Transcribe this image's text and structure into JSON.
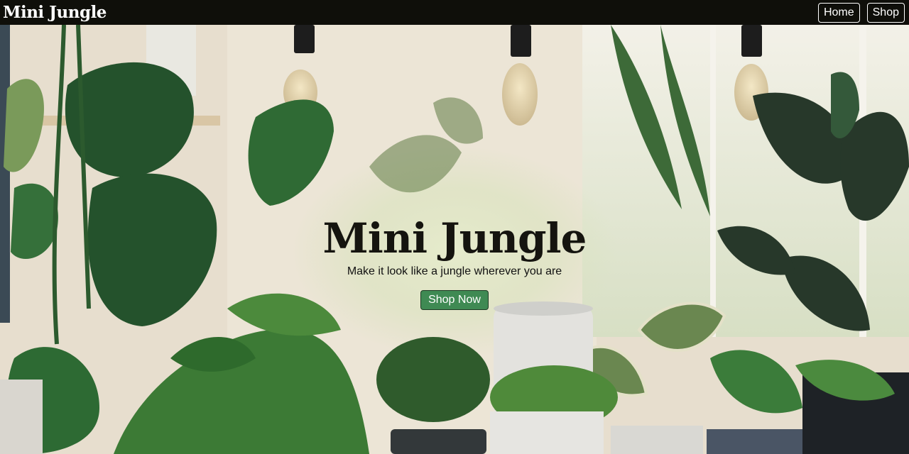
{
  "navbar": {
    "brand": "Mini Jungle",
    "links": [
      {
        "label": "Home"
      },
      {
        "label": "Shop"
      }
    ]
  },
  "hero": {
    "title": "Mini Jungle",
    "subtitle": "Make it look like a jungle wherever you are",
    "cta_label": "Shop Now"
  },
  "colors": {
    "nav_background": "#0f0f0a",
    "cta_background": "#3f8a53",
    "title_text": "#15140f"
  }
}
